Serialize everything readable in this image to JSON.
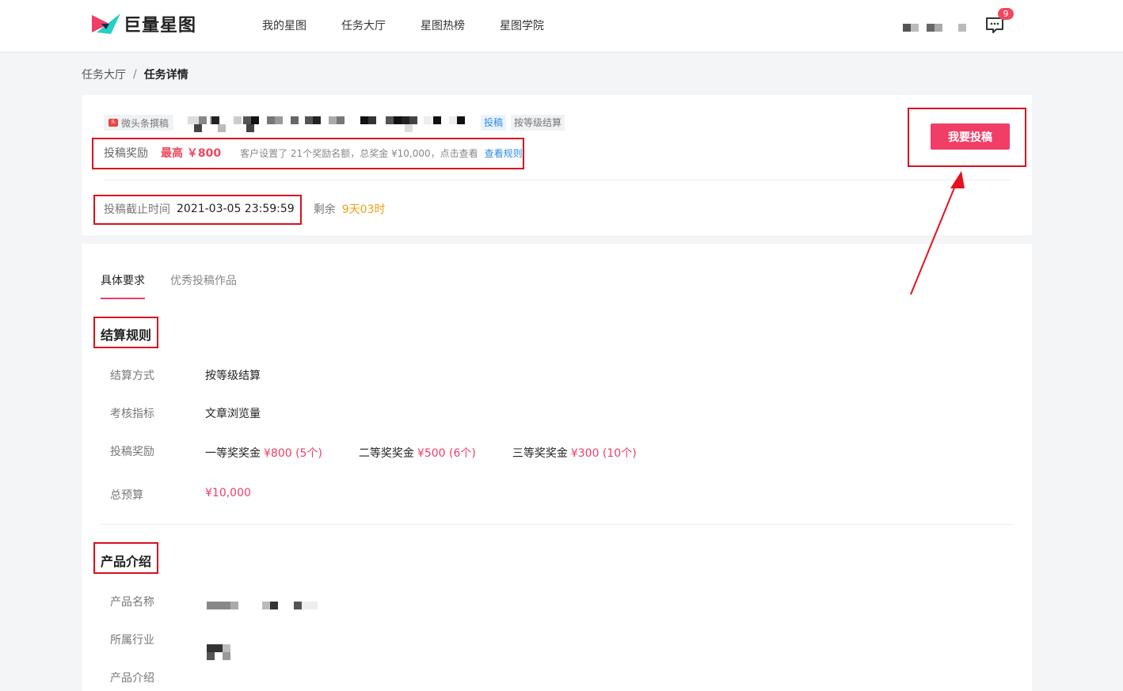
{
  "header": {
    "logo_text": "巨量星图",
    "nav": [
      "我的星图",
      "任务大厅",
      "星图热榜",
      "星图学院"
    ],
    "message_count": "9"
  },
  "breadcrumb": {
    "parent": "任务大厅",
    "separator": "/",
    "current": "任务详情"
  },
  "task": {
    "platform_tag": "微头条撰稿",
    "type_chip": "投稿",
    "settlement_chip": "按等级结算",
    "reward_label": "投稿奖励",
    "reward_max": "最高 ￥800",
    "reward_desc": "客户设置了 21个奖励名额，总奖金 ¥10,000，点击查看",
    "reward_link": "查看规则",
    "deadline_label": "投稿截止时间",
    "deadline_value": "2021-03-05 23:59:59",
    "remain_label": "剩余",
    "remain_value": "9天03时",
    "submit_label": "我要投稿"
  },
  "tabs": [
    "具体要求",
    "优秀投稿作品"
  ],
  "settlement": {
    "title": "结算规则",
    "method_label": "结算方式",
    "method_value": "按等级结算",
    "metric_label": "考核指标",
    "metric_value": "文章浏览量",
    "reward_label": "投稿奖励",
    "prizes": [
      {
        "name": "一等奖奖金",
        "amount": "¥800 (5个)"
      },
      {
        "name": "二等奖奖金",
        "amount": "¥500 (6个)"
      },
      {
        "name": "三等奖奖金",
        "amount": "¥300 (10个)"
      }
    ],
    "budget_label": "总预算",
    "budget_value": "¥10,000"
  },
  "product": {
    "title": "产品介绍",
    "name_label": "产品名称",
    "industry_label": "所属行业",
    "intro_label": "产品介绍"
  },
  "colors": {
    "accent": "#f03e66",
    "annotation": "#d9101e",
    "link": "#2f8ae0",
    "warning": "#f0a010"
  }
}
